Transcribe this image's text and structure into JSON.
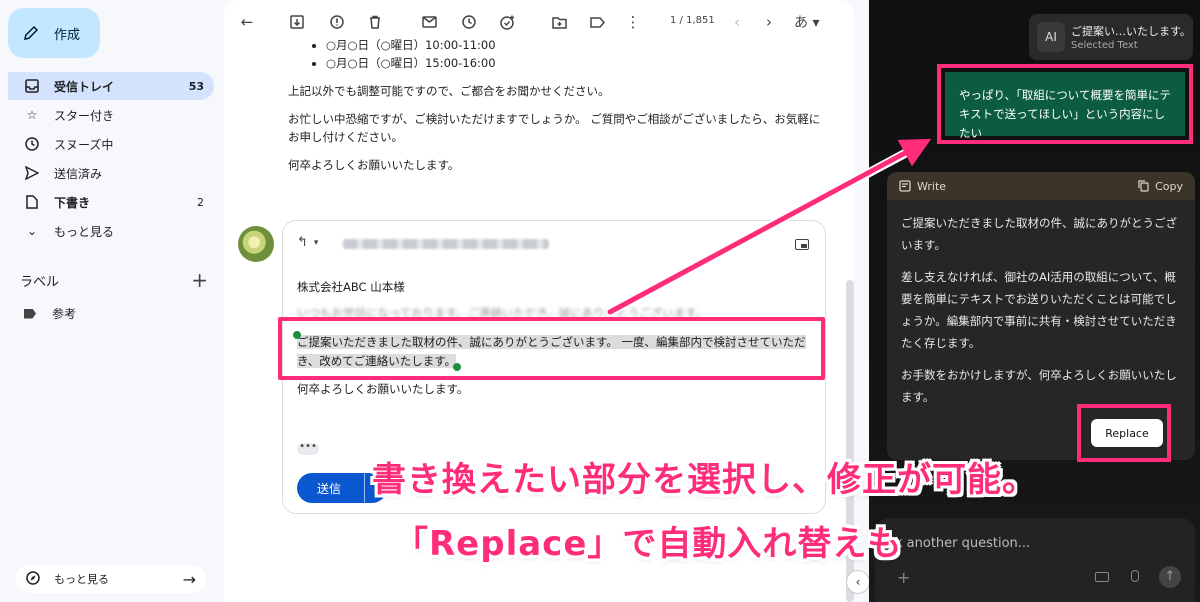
{
  "sidebar": {
    "compose_label": "作成",
    "items": [
      {
        "label": "受信トレイ",
        "count": "53"
      },
      {
        "label": "スター付き",
        "count": ""
      },
      {
        "label": "スヌーズ中",
        "count": ""
      },
      {
        "label": "送信済み",
        "count": ""
      },
      {
        "label": "下書き",
        "count": "2"
      },
      {
        "label": "もっと見る",
        "count": ""
      }
    ],
    "labels_title": "ラベル",
    "labels_add": "+",
    "label_items": [
      "参考"
    ],
    "more_bottom": "もっと見る"
  },
  "toolbar": {
    "count": "1 / 1,851",
    "lang": "あ ▾"
  },
  "thread": {
    "bullets": [
      "○月○日（○曜日）10:00-11:00",
      "○月○日（○曜日）15:00-16:00"
    ],
    "para1": "上記以外でも調整可能ですので、ご都合をお聞かせください。",
    "para2": "お忙しい中恐縮ですが、ご検討いただけますでしょうか。 ご質問やご相談がございましたら、お気軽にお申し付けください。",
    "para3": "何卒よろしくお願いいたします。"
  },
  "reply": {
    "addressee": "株式会社ABC 山本様",
    "blurred_line": "いつもお世話になっております。ご連絡いただき、誠にありがとうございます。",
    "selected_text": "ご提案いただきました取材の件、誠にありがとうございます。 一度、編集部内で検討させていただき、改めてご連絡いたします。",
    "closing": "何卒よろしくお願いいたします。",
    "dots": "•••",
    "send_label": "送信"
  },
  "chat": {
    "chip_title": "ご提案い…いたします。",
    "chip_sub": "Selected Text",
    "chip_icon": "AI",
    "prompt": "やっぱり、「取組について概要を簡単にテキストで送ってほしい」という内容にしたい",
    "write_label": "Write",
    "copy_label": "Copy",
    "write_paragraphs": [
      "ご提案いただきました取材の件、誠にありがとうございます。",
      "差し支えなければ、御社のAI活用の取組について、概要を簡単にテキストでお送りいただくことは可能でしょうか。編集部内で事前に共有・検討させていただきたく存じます。",
      "お手数をおかけしますが、何卒よろしくお願いいたします。"
    ],
    "replace_label": "Replace",
    "faint_text": "wri",
    "input_placeholder": "k another question..."
  },
  "annotation": {
    "line1": "書き換えたい部分を選択し、修正が可能。",
    "line2": "「Replace」で自動入れ替えも",
    "accent": "#ff2d79"
  }
}
